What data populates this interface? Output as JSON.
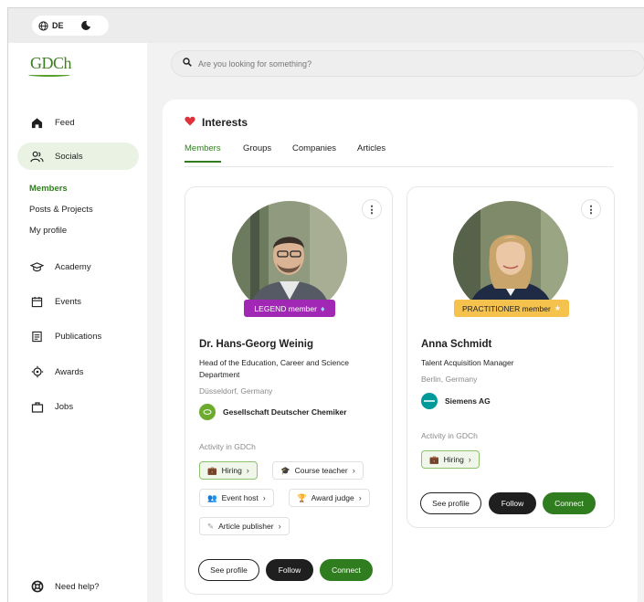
{
  "topbar": {
    "language": "DE",
    "globe_icon": "globe-icon",
    "theme_icon": "moon-icon"
  },
  "brand": {
    "logo_text": "GDCh",
    "color": "#3d7d22"
  },
  "sidebar": {
    "items": [
      {
        "label": "Feed",
        "icon": "home-icon"
      },
      {
        "label": "Socials",
        "icon": "people-icon"
      },
      {
        "label": "Academy",
        "icon": "graduation-cap-icon"
      },
      {
        "label": "Events",
        "icon": "calendar-icon"
      },
      {
        "label": "Publications",
        "icon": "document-icon"
      },
      {
        "label": "Awards",
        "icon": "award-icon"
      },
      {
        "label": "Jobs",
        "icon": "briefcase-icon"
      }
    ],
    "subitems": [
      {
        "label": "Members"
      },
      {
        "label": "Posts & Projects"
      },
      {
        "label": "My profile"
      }
    ],
    "help": {
      "label": "Need help?",
      "icon": "lifebuoy-icon"
    }
  },
  "search": {
    "placeholder": "Are you looking for something?",
    "icon": "search-icon"
  },
  "interests": {
    "title": "Interests",
    "icon": "heart-icon",
    "tabs": [
      {
        "label": "Members"
      },
      {
        "label": "Groups"
      },
      {
        "label": "Companies"
      },
      {
        "label": "Articles"
      }
    ]
  },
  "members": [
    {
      "name": "Dr. Hans-Georg Weinig",
      "badge": "LEGEND member",
      "badge_color": "#a128b5",
      "role": "Head of the Education, Career and Science Department",
      "location": "Düsseldorf, Germany",
      "org": "Gesellschaft Deutscher Chemiker",
      "activity_label": "Activity in GDCh",
      "chips": [
        {
          "label": "Hiring",
          "icon": "💼"
        },
        {
          "label": "Course teacher",
          "icon": "🎓"
        },
        {
          "label": "Event host",
          "icon": "👥"
        },
        {
          "label": "Award judge",
          "icon": "🏆"
        },
        {
          "label": "Article publisher",
          "icon": "✎"
        }
      ],
      "actions": {
        "see_profile": "See profile",
        "follow": "Follow",
        "connect": "Connect"
      }
    },
    {
      "name": "Anna Schmidt",
      "badge": "PRACTITIONER member",
      "badge_color": "#f4c24d",
      "role": "Talent Acquisition Manager",
      "location": "Berlin, Germany",
      "org": "Siemens AG",
      "activity_label": "Activity in GDCh",
      "chips": [
        {
          "label": "Hiring",
          "icon": "💼"
        }
      ],
      "actions": {
        "see_profile": "See profile",
        "follow": "Follow",
        "connect": "Connect"
      }
    }
  ],
  "colors": {
    "accent": "#2f7d1e",
    "dark": "#1f1f1f"
  }
}
